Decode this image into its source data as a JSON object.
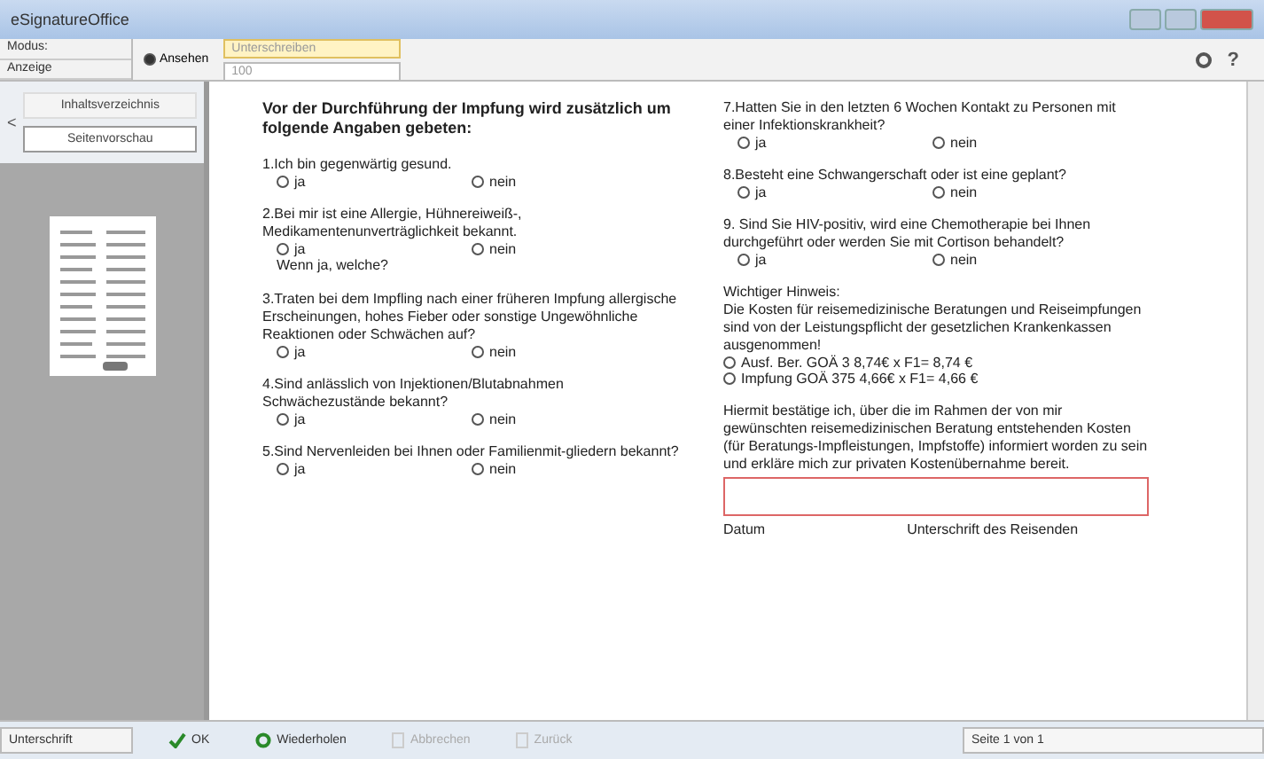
{
  "window": {
    "title": "eSignatureOffice"
  },
  "toolbar": {
    "mode_label": "Modus:",
    "view_label": "Anzeige",
    "mode_option": {
      "label": "Ansehen",
      "selected": true
    },
    "mode_dropdown": "Unterschreiben",
    "zoom_dropdown": "100",
    "help": "?"
  },
  "sidebar": {
    "buttons": [
      {
        "label": "Inhaltsverzeichnis",
        "selected": false
      },
      {
        "label": "Seitenvorschau",
        "selected": true
      }
    ],
    "collapse": "<"
  },
  "document": {
    "left": [
      {
        "kind": "heading",
        "text": "Vor der Durchführung der Impfung wird zusätzlich um folgende Angaben gebeten:"
      },
      {
        "kind": "question",
        "text": "1.Ich bin gegenwärtig gesund.",
        "options": [
          {
            "label": "ja",
            "selected": false
          },
          {
            "label": "nein",
            "selected": false
          }
        ]
      },
      {
        "kind": "question",
        "text": "2.Bei mir ist eine Allergie, Hühnereiweiß-, Medikamentenunverträglichkeit bekannt.",
        "options": [
          {
            "label": "ja",
            "selected": false
          },
          {
            "label": "nein",
            "selected": false
          }
        ],
        "followup": "Wenn ja, welche?"
      },
      {
        "kind": "question",
        "text": "3.Traten bei dem Impfling nach einer früheren Impfung allergische Erscheinungen, hohes Fieber oder sonstige Ungewöhnliche Reaktionen oder Schwächen auf?",
        "options": [
          {
            "label": "ja",
            "selected": false
          },
          {
            "label": "nein",
            "selected": false
          }
        ]
      },
      {
        "kind": "question",
        "text": "4.Sind anlässlich von Injektionen/Blutabnahmen Schwächezustände bekannt?",
        "options": [
          {
            "label": "ja",
            "selected": false
          },
          {
            "label": "nein",
            "selected": false
          }
        ]
      },
      {
        "kind": "question",
        "text": "5.Sind Nervenleiden bei Ihnen oder Familienmit-gliedern bekannt?",
        "options": [
          {
            "label": "ja",
            "selected": false
          },
          {
            "label": "nein",
            "selected": false
          }
        ]
      }
    ],
    "right": [
      {
        "kind": "question",
        "text": "7.Hatten Sie in den letzten 6 Wochen Kontakt zu Personen mit einer Infektionskrankheit?",
        "options": [
          {
            "label": "ja",
            "selected": false
          },
          {
            "label": "nein",
            "selected": false
          }
        ]
      },
      {
        "kind": "question",
        "text": "8.Besteht eine Schwangerschaft oder ist eine geplant?",
        "options": [
          {
            "label": "ja",
            "selected": false
          },
          {
            "label": "nein",
            "selected": false
          }
        ]
      },
      {
        "kind": "question",
        "text": "9. Sind Sie HIV-positiv, wird eine Chemotherapie bei Ihnen durchgeführt oder werden Sie mit Cortison behandelt?",
        "options": [
          {
            "label": "ja",
            "selected": false
          },
          {
            "label": "nein",
            "selected": false
          }
        ]
      },
      {
        "kind": "notice",
        "title": "Wichtiger Hinweis:",
        "text": "Die Kosten für reisemedizinische Beratungen und Reiseimpfungen sind von der Leistungspflicht der gesetzlichen Krankenkassen ausgenommen!",
        "options": [
          {
            "label": "Ausf. Ber. GOÄ 3  8,74€ x F1= 8,74 €",
            "selected": false
          },
          {
            "label": "Impfung GOÄ 375  4,66€ x F1= 4,66 €",
            "selected": false
          }
        ]
      },
      {
        "kind": "signature",
        "text": "Hiermit bestätige ich, über die im Rahmen der von mir gewünschten reisemedizinischen Beratung entstehenden Kosten (für Beratungs-Impfleistungen, Impfstoffe) informiert worden zu sein und erkläre mich zur privaten Kostenübernahme bereit.",
        "date_label": "Datum",
        "sign_label": "Unterschrift des Reisenden"
      }
    ]
  },
  "status_bar": {
    "mode": "Unterschrift",
    "buttons": [
      {
        "kind": "ok",
        "label": "OK",
        "disabled": false
      },
      {
        "kind": "repeat",
        "label": "Wiederholen",
        "disabled": false
      },
      {
        "kind": "cancel",
        "label": "Abbrechen",
        "disabled": true
      },
      {
        "kind": "back",
        "label": "Zurück",
        "disabled": true
      }
    ],
    "page": "Seite 1 von 1"
  }
}
